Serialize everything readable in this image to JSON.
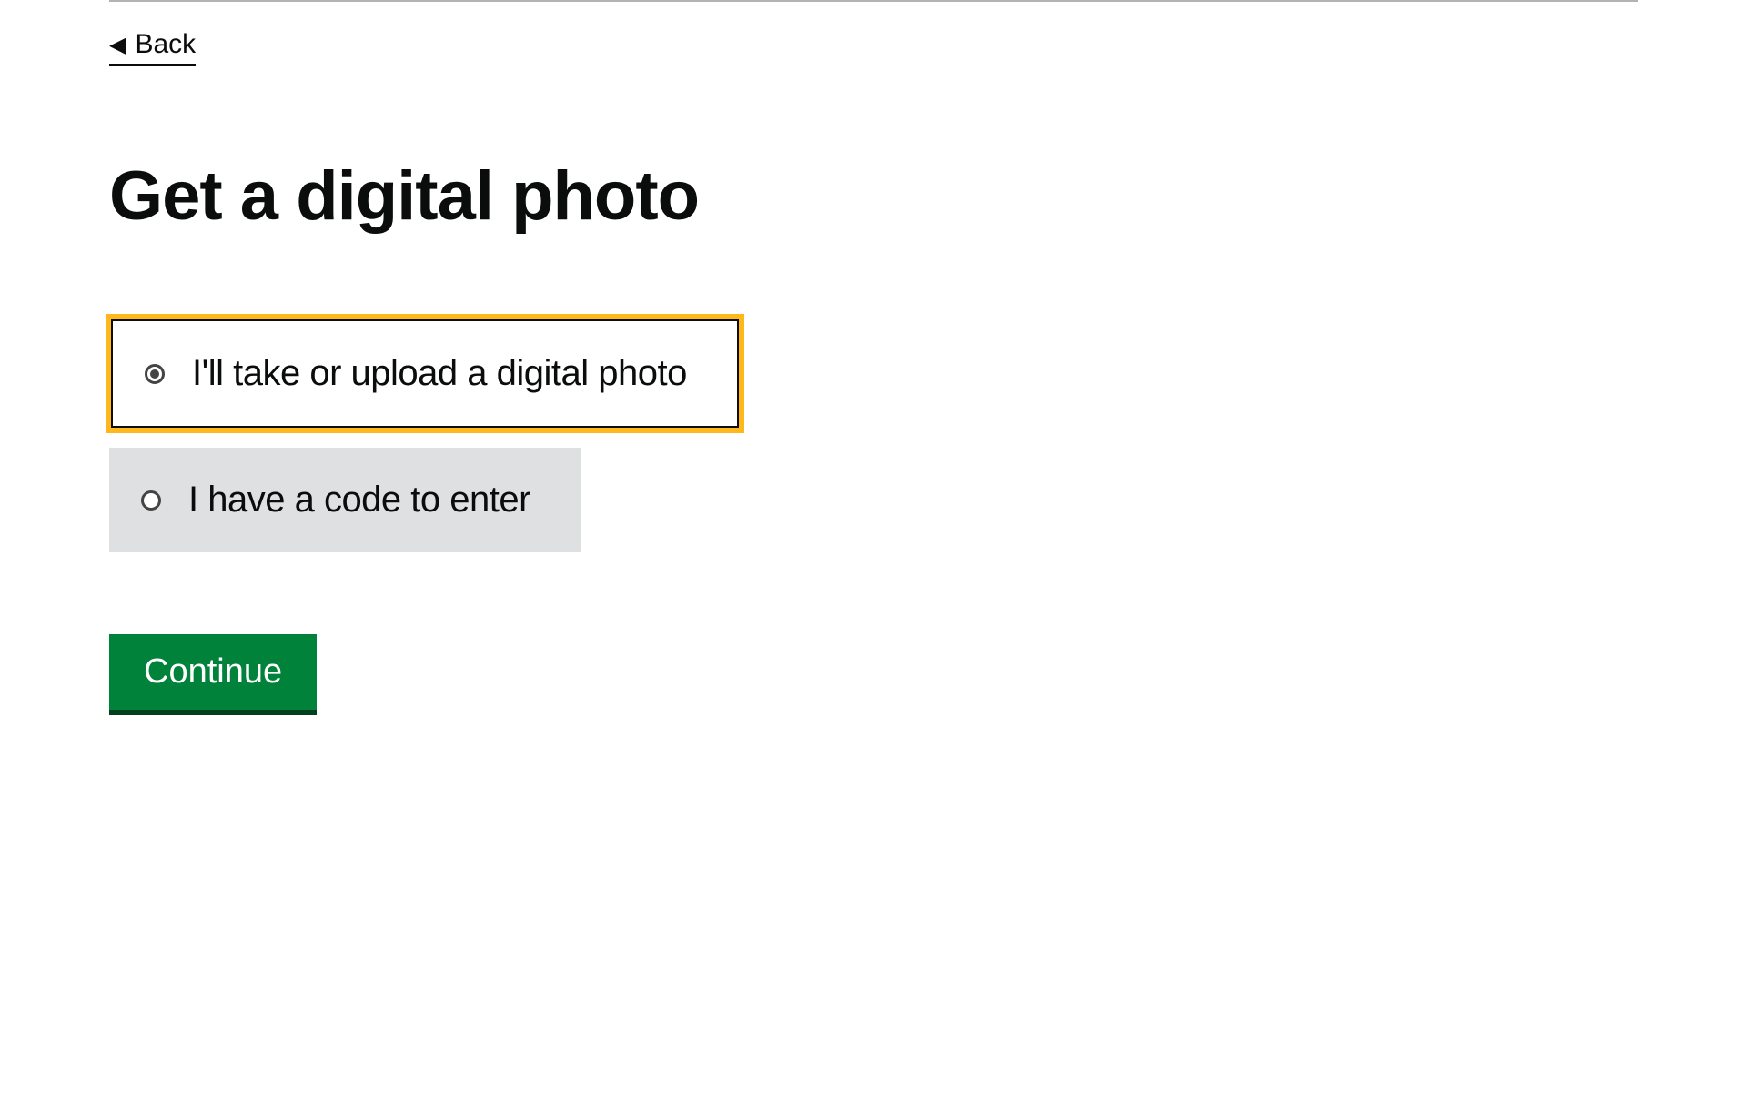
{
  "back_label": "Back",
  "heading": "Get a digital photo",
  "options": {
    "upload": {
      "label": "I'll take or upload a digital photo",
      "selected": true
    },
    "code": {
      "label": "I have a code to enter",
      "selected": false
    }
  },
  "continue_label": "Continue"
}
